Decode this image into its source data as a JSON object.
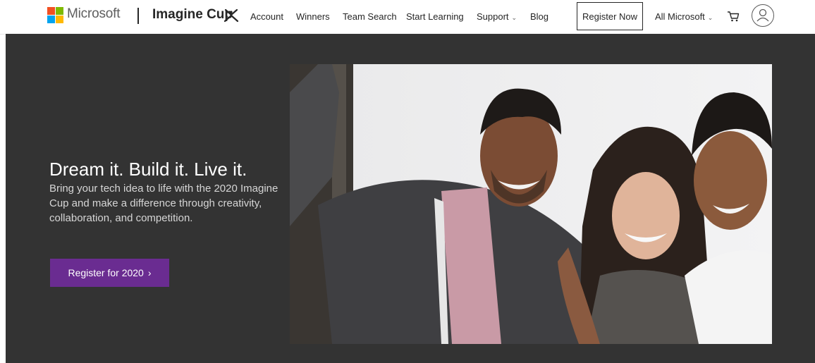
{
  "header": {
    "brand": "Microsoft",
    "site_title": "Imagine Cup",
    "nav": [
      "Account",
      "Winners",
      "Team Search",
      "Start Learning",
      "Support",
      "Blog"
    ],
    "register_now": "Register Now",
    "all_microsoft": "All Microsoft",
    "icons": {
      "cart": "cart-icon",
      "account": "user-avatar-icon",
      "dropdown": "chevron-down-icon"
    }
  },
  "hero": {
    "headline": "Dream it. Build it. Live it.",
    "description": "Bring your tech idea to life with the 2020 Imagine Cup and make a difference through creativity, collaboration, and competition.",
    "cta": "Register for 2020",
    "cta_arrow": "›"
  },
  "colors": {
    "hero_bg": "#333333",
    "cta_bg": "#6a2c91",
    "logo": [
      "#f25022",
      "#7fba00",
      "#00a4ef",
      "#ffb900"
    ]
  }
}
